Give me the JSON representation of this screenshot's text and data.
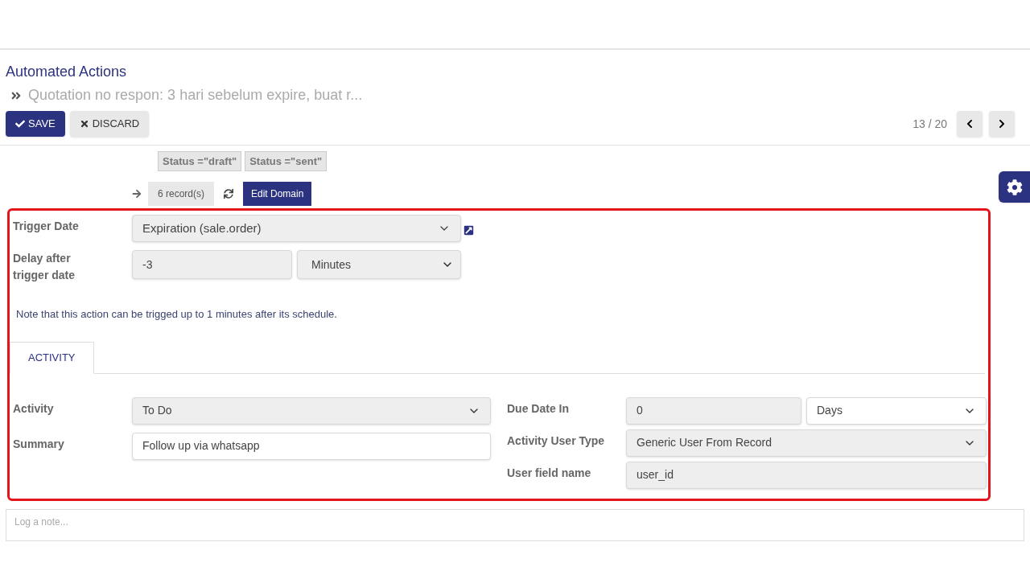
{
  "breadcrumb": {
    "parent": "Automated Actions",
    "current": "Quotation no respon: 3 hari sebelum expire, buat r..."
  },
  "buttons": [
    {
      "kind": "primary",
      "label": "SAVE"
    },
    {
      "kind": "secondary",
      "label": "DISCARD"
    }
  ],
  "pager": {
    "text": "13 / 20"
  },
  "domain": {
    "chips": [
      "Status =**\"draft\"**",
      "Status =**\"sent\"**"
    ],
    "records": "6 record(s)",
    "edit_button": "Edit Domain"
  },
  "trigger": {
    "label": "Trigger Date",
    "value": "Expiration (sale.order)"
  },
  "delay": {
    "label": "Delay after trigger date",
    "value": "-3",
    "unit": "Minutes"
  },
  "note": "Note that this action can be trigged up to 1 minutes after its schedule.",
  "tabs": [
    {
      "label": "ACTIVITY",
      "selected": true
    }
  ],
  "left_fields": [
    {
      "label": "Activity",
      "kind": "select",
      "value": "To Do",
      "shaded": true
    },
    {
      "label": "Summary",
      "kind": "input",
      "value": "Follow up via whatsapp",
      "shaded": false
    }
  ],
  "right_fields": [
    {
      "label": "Due Date In",
      "kind": "number_unit",
      "value": "0",
      "unit": "Days",
      "shaded": true
    },
    {
      "label": "Activity User Type",
      "kind": "select",
      "value": "Generic User From Record",
      "shaded": true
    },
    {
      "label": "User field name",
      "kind": "input",
      "value": "user_id",
      "shaded": true
    }
  ],
  "chatter": {
    "placeholder": "Log a note..."
  }
}
